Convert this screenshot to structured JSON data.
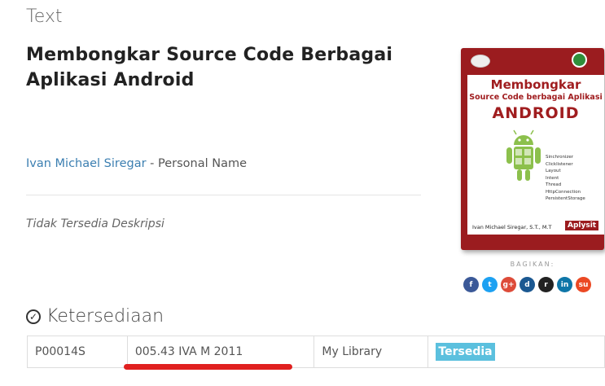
{
  "header": {
    "type_label": "Text"
  },
  "book": {
    "title": "Membongkar Source Code Berbagai Aplikasi Android",
    "author_name": "Ivan Michael Siregar",
    "author_role": " - Personal Name",
    "description": "Tidak Tersedia Deskripsi"
  },
  "cover": {
    "line1": "Membongkar",
    "line2": "Source Code berbagai Aplikasi",
    "line3": "ANDROID",
    "terms": [
      "Sinchronizer",
      "Clicklistener",
      "Layout",
      "Intent",
      "Thread",
      "HttpConnection",
      "PersistentStorage"
    ],
    "author": "Ivan Michael Siregar, S.T., M.T",
    "publisher": "Aplysit"
  },
  "share": {
    "label": "BAGIKAN:",
    "icons": [
      {
        "name": "facebook-icon",
        "glyph": "f",
        "color": "#3b5998"
      },
      {
        "name": "twitter-icon",
        "glyph": "t",
        "color": "#1da1f2"
      },
      {
        "name": "google-plus-icon",
        "glyph": "g+",
        "color": "#dd4b39"
      },
      {
        "name": "digg-icon",
        "glyph": "d",
        "color": "#1b5891"
      },
      {
        "name": "reddit-icon",
        "glyph": "r",
        "color": "#222222"
      },
      {
        "name": "linkedin-icon",
        "glyph": "in",
        "color": "#0e76a8"
      },
      {
        "name": "stumbleupon-icon",
        "glyph": "su",
        "color": "#eb4924"
      }
    ]
  },
  "availability": {
    "heading": "Ketersediaan",
    "rows": [
      {
        "item_code": "P00014S",
        "call_number": "005.43 IVA M 2011",
        "location": "My Library",
        "status": "Tersedia"
      }
    ],
    "status_color": "#5bc0de"
  }
}
